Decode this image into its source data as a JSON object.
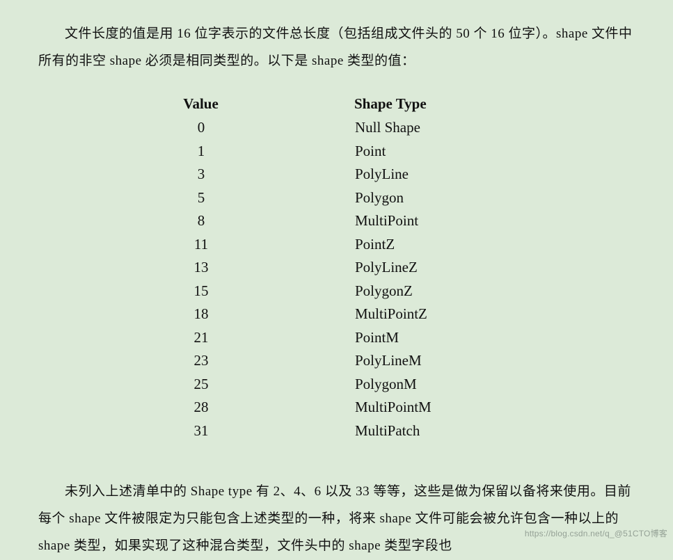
{
  "paragraph_top": "文件长度的值是用 16 位字表示的文件总长度（包括组成文件头的 50 个 16 位字）。shape 文件中所有的非空 shape 必须是相同类型的。以下是 shape 类型的值：",
  "table": {
    "header_value": "Value",
    "header_type": "Shape Type",
    "rows": [
      {
        "value": "0",
        "type": "Null Shape"
      },
      {
        "value": "1",
        "type": "Point"
      },
      {
        "value": "3",
        "type": "PolyLine"
      },
      {
        "value": "5",
        "type": "Polygon"
      },
      {
        "value": "8",
        "type": "MultiPoint"
      },
      {
        "value": "11",
        "type": "PointZ"
      },
      {
        "value": "13",
        "type": "PolyLineZ"
      },
      {
        "value": "15",
        "type": "PolygonZ"
      },
      {
        "value": "18",
        "type": "MultiPointZ"
      },
      {
        "value": "21",
        "type": "PointM"
      },
      {
        "value": "23",
        "type": "PolyLineM"
      },
      {
        "value": "25",
        "type": "PolygonM"
      },
      {
        "value": "28",
        "type": "MultiPointM"
      },
      {
        "value": "31",
        "type": "MultiPatch"
      }
    ]
  },
  "paragraph_bottom": "未列入上述清单中的 Shape type 有 2、4、6 以及 33 等等，这些是做为保留以备将来使用。目前每个 shape 文件被限定为只能包含上述类型的一种，将来 shape 文件可能会被允许包含一种以上的 shape 类型，如果实现了这种混合类型，文件头中的 shape 类型字段也",
  "watermark": "https://blog.csdn.net/q_@51CTO博客"
}
